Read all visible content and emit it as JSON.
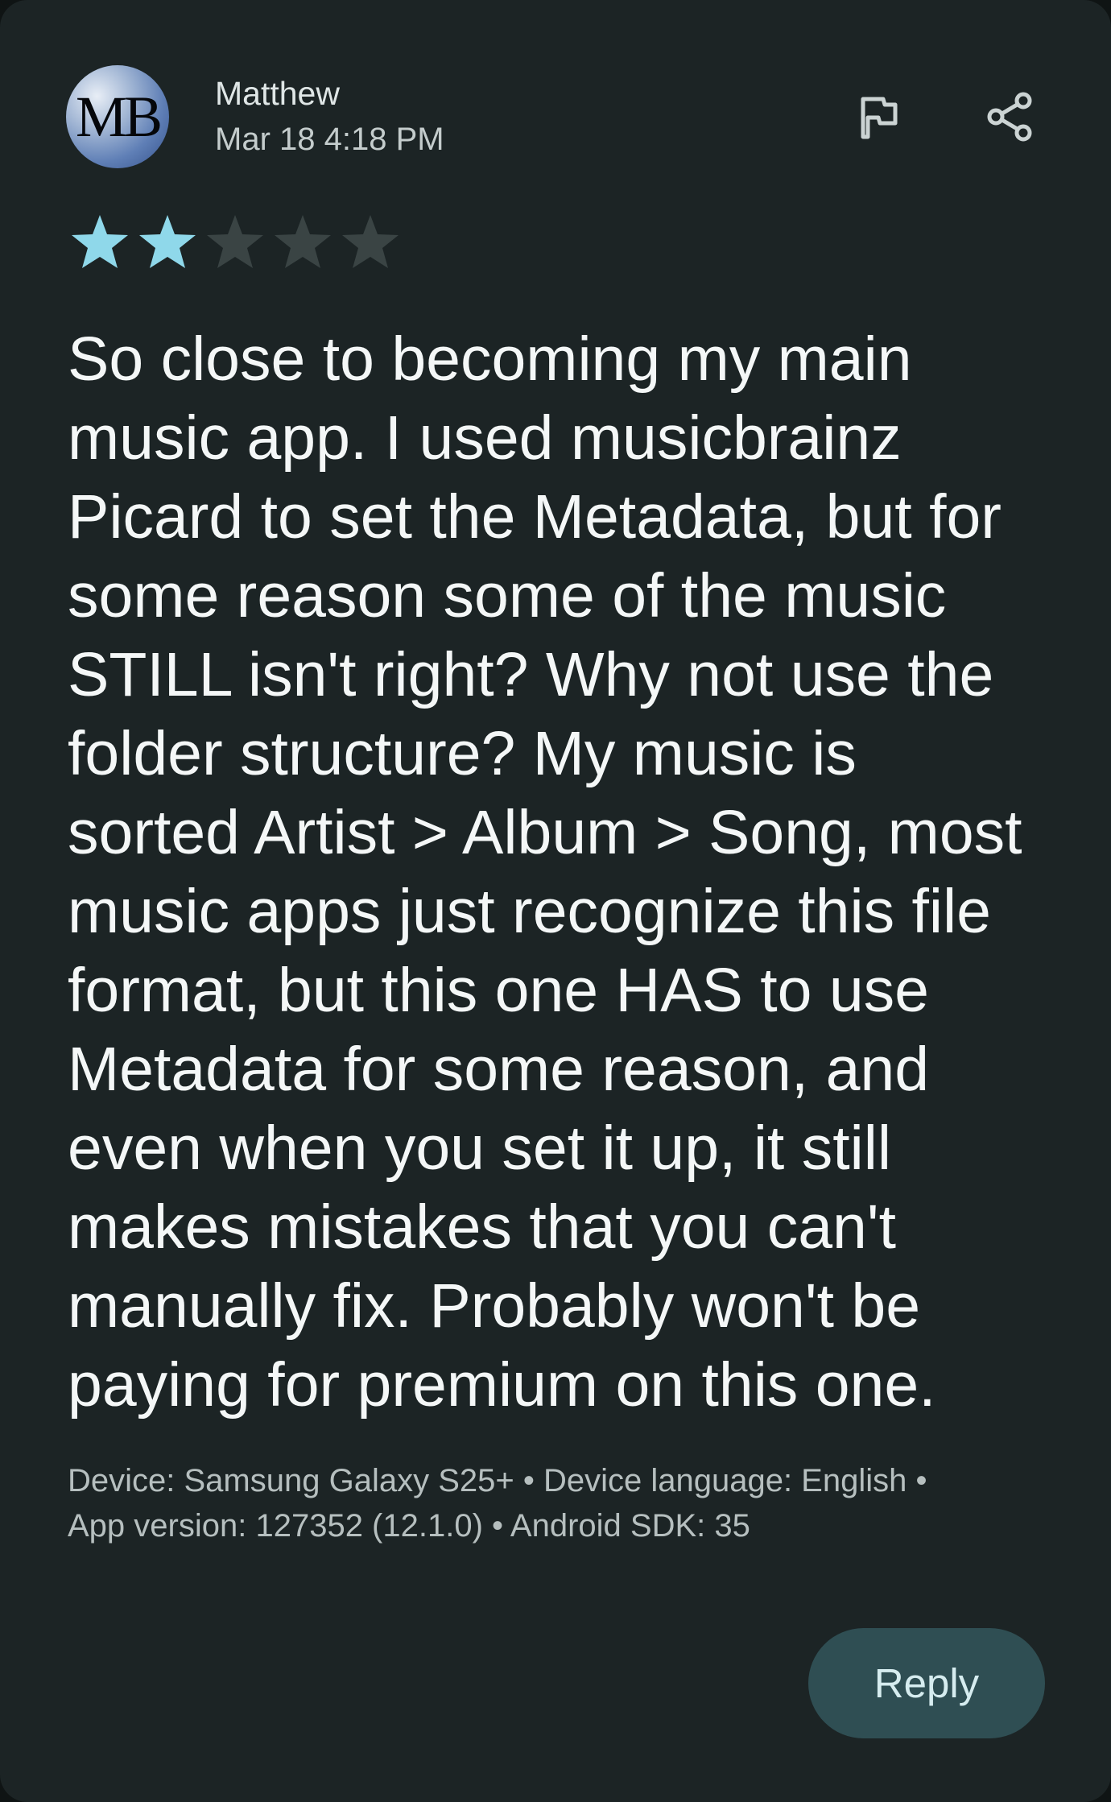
{
  "review": {
    "avatar_initials": "MB",
    "author": "Matthew",
    "date": "Mar 18 4:18 PM",
    "rating": 2,
    "max_rating": 5,
    "text": "So close to becoming my main\nmusic app. I used musicbrainz\nPicard to set the Metadata, but for\nsome reason some of the music\nSTILL isn't right? Why not use the\nfolder structure? My music is\nsorted Artist > Album > Song, most\nmusic apps just recognize this file\nformat, but this one HAS to use\nMetadata for some reason, and\neven when you set it up, it still\nmakes mistakes that you can't\nmanually fix. Probably won't be\npaying for premium on this one.",
    "device_info": "Device: Samsung Galaxy S25+ • Device language: English •\nApp version: 127352 (12.1.0) • Android SDK: 35"
  },
  "actions": {
    "flag_icon": "flag-icon",
    "share_icon": "share-icon",
    "reply_label": "Reply"
  },
  "colors": {
    "background": "#1c2425",
    "star_filled": "#8fd8ea",
    "star_empty": "#3a4444",
    "reply_button": "#2f4e53"
  }
}
